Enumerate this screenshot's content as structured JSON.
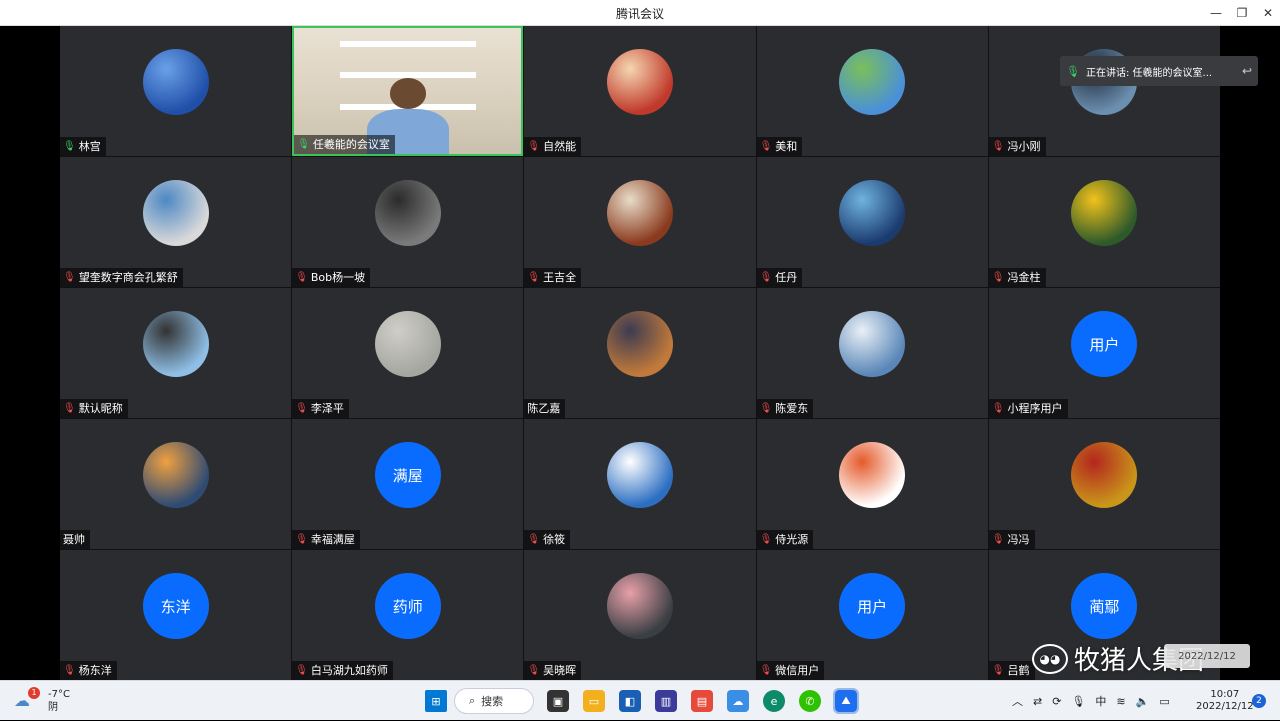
{
  "window": {
    "title": "腾讯会议",
    "minimize": "—",
    "restore": "❐",
    "close": "✕"
  },
  "speaking": {
    "label": "正在讲话: 任羲能的会议室..."
  },
  "participants": [
    {
      "name": "林宫",
      "mic": "on",
      "avatar": {
        "type": "image",
        "color": "#1f4fa8",
        "accent": "#6aa0e8"
      }
    },
    {
      "name": "任羲能的会议室",
      "mic": "on",
      "video": true
    },
    {
      "name": "自然能",
      "mic": "muted",
      "avatar": {
        "type": "image",
        "color": "#c0392b",
        "accent": "#f5d6b0"
      }
    },
    {
      "name": "美和",
      "mic": "muted",
      "avatar": {
        "type": "image",
        "color": "#4a90d9",
        "accent": "#7bbf5a"
      }
    },
    {
      "name": "冯小刚",
      "mic": "muted",
      "avatar": {
        "type": "image",
        "color": "#6c8fb0",
        "accent": "#1d2a3a"
      }
    },
    {
      "name": "望奎数字商会孔繁舒",
      "mic": "muted",
      "avatar": {
        "type": "image",
        "color": "#d9d9d9",
        "accent": "#4d88c4"
      }
    },
    {
      "name": "Bob杨一坡",
      "mic": "muted",
      "avatar": {
        "type": "image",
        "color": "#7a7a7a",
        "accent": "#2b2b2b"
      }
    },
    {
      "name": "王吉全",
      "mic": "muted",
      "avatar": {
        "type": "image",
        "color": "#8a3a1e",
        "accent": "#e8dcc8"
      }
    },
    {
      "name": "任丹",
      "mic": "muted",
      "avatar": {
        "type": "image",
        "color": "#1b3b6f",
        "accent": "#6fb3e0"
      }
    },
    {
      "name": "冯金柱",
      "mic": "muted",
      "avatar": {
        "type": "image",
        "color": "#2e5a2a",
        "accent": "#f2c21b"
      }
    },
    {
      "name": "默认昵称",
      "mic": "muted",
      "avatar": {
        "type": "image",
        "color": "#8fbfe6",
        "accent": "#333"
      }
    },
    {
      "name": "李泽平",
      "mic": "muted",
      "avatar": {
        "type": "image",
        "color": "#a6a6a0",
        "accent": "#cfcfc8"
      }
    },
    {
      "name": "陈乙嘉",
      "mic": "none",
      "avatar": {
        "type": "image",
        "color": "#c27a3a",
        "accent": "#3d3b52"
      }
    },
    {
      "name": "陈爱东",
      "mic": "muted",
      "avatar": {
        "type": "image",
        "color": "#5b87b8",
        "accent": "#e9f0f6"
      }
    },
    {
      "name": "小程序用户",
      "mic": "muted",
      "avatar": {
        "type": "text",
        "text": "用户"
      }
    },
    {
      "name": "聂帅",
      "mic": "none",
      "avatar": {
        "type": "image",
        "color": "#2f4b73",
        "accent": "#f0a040"
      }
    },
    {
      "name": "幸福满屋",
      "mic": "muted",
      "avatar": {
        "type": "text",
        "text": "满屋"
      }
    },
    {
      "name": "徐筱",
      "mic": "muted",
      "avatar": {
        "type": "image",
        "color": "#2c6fc2",
        "accent": "#ffffff"
      }
    },
    {
      "name": "侍光源",
      "mic": "muted",
      "avatar": {
        "type": "image",
        "color": "#ffffff",
        "accent": "#e55a2b"
      }
    },
    {
      "name": "冯冯",
      "mic": "muted",
      "avatar": {
        "type": "image",
        "color": "#c9961a",
        "accent": "#b3261e"
      }
    },
    {
      "name": "杨东洋",
      "mic": "muted",
      "avatar": {
        "type": "text",
        "text": "东洋"
      }
    },
    {
      "name": "白马湖九如药师",
      "mic": "muted",
      "avatar": {
        "type": "text",
        "text": "药师"
      }
    },
    {
      "name": "吴晓晖",
      "mic": "muted",
      "avatar": {
        "type": "image",
        "color": "#3a3f44",
        "accent": "#e8a0a8"
      }
    },
    {
      "name": "微信用户",
      "mic": "muted",
      "avatar": {
        "type": "text",
        "text": "用户"
      }
    },
    {
      "name": "吕鹤",
      "mic": "muted",
      "avatar": {
        "type": "text",
        "text": "蔺鄢"
      }
    }
  ],
  "watermark": {
    "text": "牧猪人集团",
    "badge_date": "2022/12/12"
  },
  "taskbar": {
    "weather_temp": "-7°C",
    "weather_desc": "阴",
    "weather_badge": "1",
    "search_label": "搜索",
    "tray_ime": "中",
    "time": "10:07",
    "date": "2022/12/12",
    "notif_count": "2"
  }
}
